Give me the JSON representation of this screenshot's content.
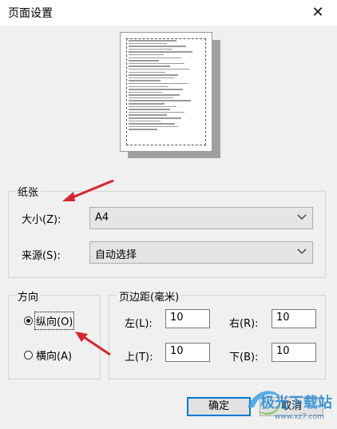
{
  "window": {
    "title": "页面设置",
    "close_glyph": "✕"
  },
  "paper_group": {
    "label": "纸张",
    "size_label": "大小(Z):",
    "size_value": "A4",
    "source_label": "来源(S):",
    "source_value": "自动选择"
  },
  "orientation_group": {
    "label": "方向",
    "portrait_label": "纵向(O)",
    "landscape_label": "横向(A)",
    "selected": "portrait"
  },
  "margins_group": {
    "label": "页边距(毫米)",
    "left_label": "左(L):",
    "left_value": "10",
    "right_label": "右(R):",
    "right_value": "10",
    "top_label": "上(T):",
    "top_value": "10",
    "bottom_label": "下(B):",
    "bottom_value": "10"
  },
  "buttons": {
    "ok_label": "确定",
    "cancel_label": "取消"
  },
  "watermark": {
    "text": "极光下载站",
    "url": "www.xz7.com"
  },
  "colors": {
    "annotation_arrow": "#d9252a",
    "accent": "#0078d7"
  }
}
